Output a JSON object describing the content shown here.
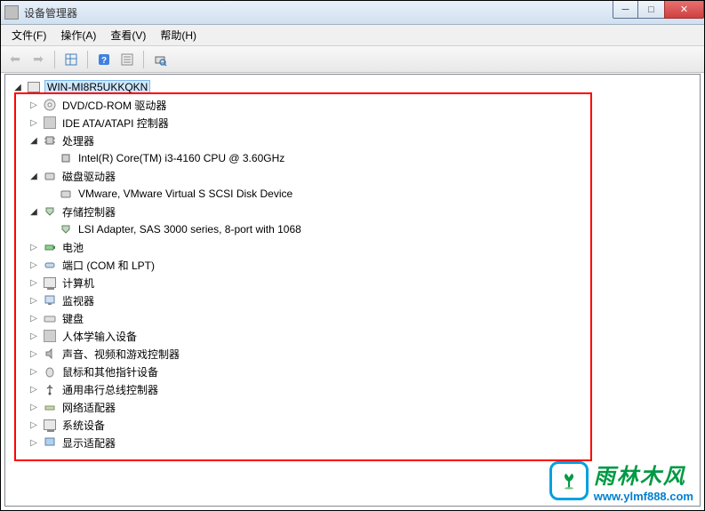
{
  "window": {
    "title": "设备管理器"
  },
  "menu": {
    "file": "文件(F)",
    "action": "操作(A)",
    "view": "查看(V)",
    "help": "帮助(H)"
  },
  "tree": {
    "root": "WIN-MI8R5UKKQKN",
    "dvd": "DVD/CD-ROM 驱动器",
    "ide": "IDE ATA/ATAPI 控制器",
    "processor": "处理器",
    "processor_child": "Intel(R) Core(TM) i3-4160 CPU @ 3.60GHz",
    "disk": "磁盘驱动器",
    "disk_child": "VMware, VMware Virtual S SCSI Disk Device",
    "storage": "存储控制器",
    "storage_child": "LSI Adapter, SAS 3000 series, 8-port with 1068",
    "battery": "电池",
    "ports": "端口 (COM 和 LPT)",
    "computer": "计算机",
    "monitor": "监视器",
    "keyboard": "键盘",
    "hid": "人体学输入设备",
    "sound": "声音、视频和游戏控制器",
    "mouse": "鼠标和其他指针设备",
    "usb": "通用串行总线控制器",
    "network": "网络适配器",
    "system": "系统设备",
    "display": "显示适配器"
  },
  "watermark": {
    "brand": "雨林木风",
    "url": "www.ylmf888.com"
  }
}
